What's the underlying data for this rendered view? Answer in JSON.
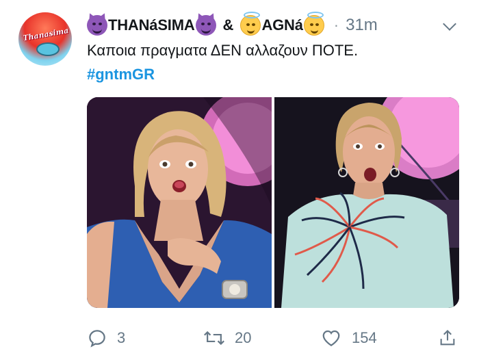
{
  "tweet": {
    "author": {
      "name_part1": "THANáSIMA",
      "ampersand": "&",
      "name_part2": "AGNá",
      "avatar_text": "Thanasima",
      "emojis": [
        "smiling-devil-emoji",
        "angel-emoji"
      ]
    },
    "separator": "·",
    "time": "31m",
    "text": "Καποια πραγματα ΔΕΝ αλλαζουν ΠΟΤΕ.",
    "hashtag": "#gntmGR",
    "media": {
      "count": 2,
      "description_left": "left-photo",
      "description_right": "right-photo"
    },
    "actions": {
      "reply_count": "3",
      "retweet_count": "20",
      "like_count": "154"
    }
  },
  "colors": {
    "text": "#14171a",
    "secondary": "#657786",
    "hashtag": "#1b95e0",
    "devil_emoji": "#8e57b8",
    "angel_emoji": "#ffcc4d"
  },
  "icons": [
    "chevron-down-icon",
    "reply-icon",
    "retweet-icon",
    "like-icon",
    "share-icon"
  ]
}
